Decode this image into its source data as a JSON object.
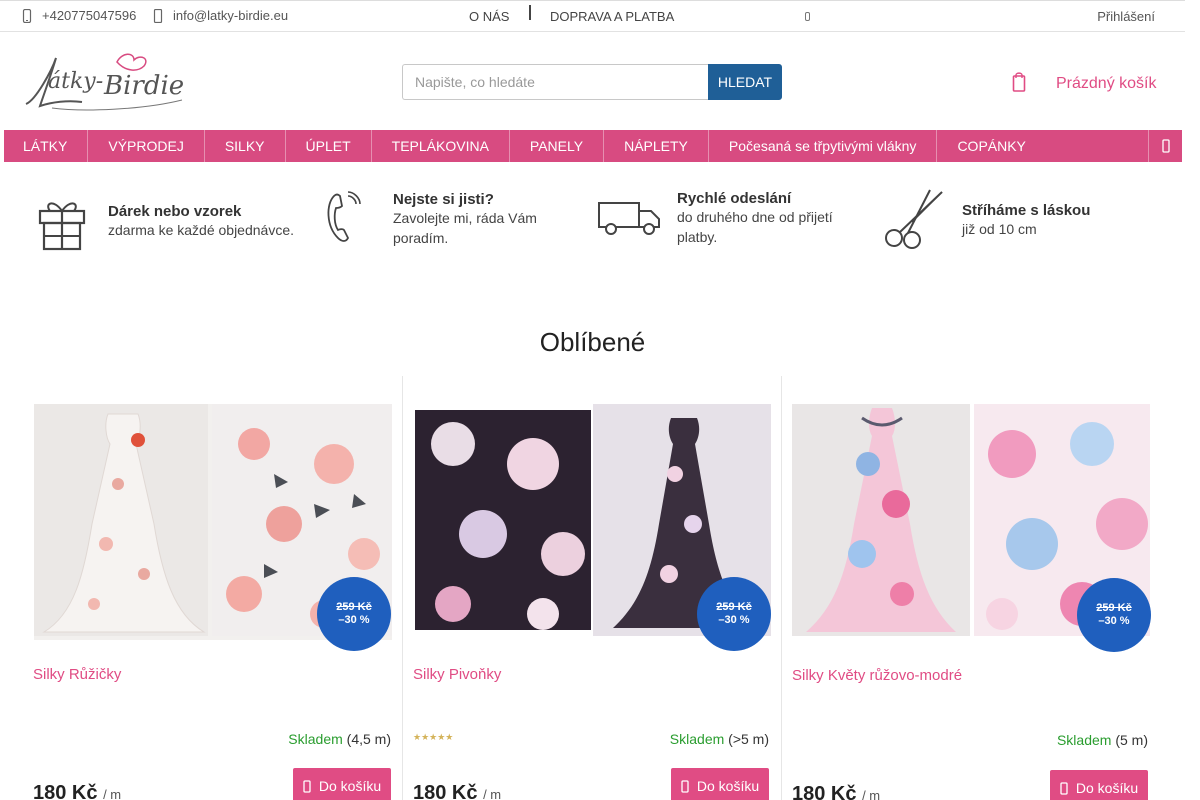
{
  "topbar": {
    "phone": "+420775047596",
    "email": "info@latky-birdie.eu",
    "links": [
      "O NÁS",
      "DOPRAVA A PLATBA"
    ],
    "login": "Přihlášení"
  },
  "logo": {
    "text": "Látky-Birdie"
  },
  "search": {
    "placeholder": "Napište, co hledáte",
    "button": "HLEDAT"
  },
  "cart": {
    "label": "Prázdný košík"
  },
  "nav": [
    "LÁTKY",
    "VÝPRODEJ",
    "SILKY",
    "ÚPLET",
    "TEPLÁKOVINA",
    "PANELY",
    "NÁPLETY",
    "Počesaná se třpytivými vlákny",
    "COPÁNKY"
  ],
  "benefits": [
    {
      "title": "Dárek nebo vzorek",
      "text": "zdarma ke každé objednávce.",
      "icon": "gift-icon"
    },
    {
      "title": "Nejste si jisti?",
      "text": "Zavolejte mi, ráda Vám poradím.",
      "icon": "phone-icon"
    },
    {
      "title": "Rychlé odeslání",
      "text": "do druhého dne od přijetí platby.",
      "icon": "truck-icon"
    },
    {
      "title": "Stříháme s láskou",
      "text": "již od 10 cm",
      "icon": "scissors-icon"
    }
  ],
  "section_title": "Oblíbené",
  "products": [
    {
      "name": "Silky Růžičky",
      "old_price": "259 Kč",
      "discount": "–30 %",
      "stock_label": "Skladem",
      "stock_qty": "(4,5 m)",
      "price": "180 Kč",
      "unit": "/ m",
      "buy": "Do košíku",
      "stars": ""
    },
    {
      "name": "Silky Pivoňky",
      "old_price": "259 Kč",
      "discount": "–30 %",
      "stock_label": "Skladem",
      "stock_qty": "(>5 m)",
      "price": "180 Kč",
      "unit": "/ m",
      "buy": "Do košíku",
      "stars": "★★★★★"
    },
    {
      "name": "Silky Květy růžovo-modré",
      "old_price": "259 Kč",
      "discount": "–30 %",
      "stock_label": "Skladem",
      "stock_qty": "(5 m)",
      "price": "180 Kč",
      "unit": "/ m",
      "buy": "Do košíku",
      "stars": ""
    }
  ],
  "colors": {
    "brand_pink": "#d84b81",
    "button_blue": "#1f5f97",
    "badge_blue": "#1f5fbe",
    "stock_green": "#2a9d2f"
  }
}
